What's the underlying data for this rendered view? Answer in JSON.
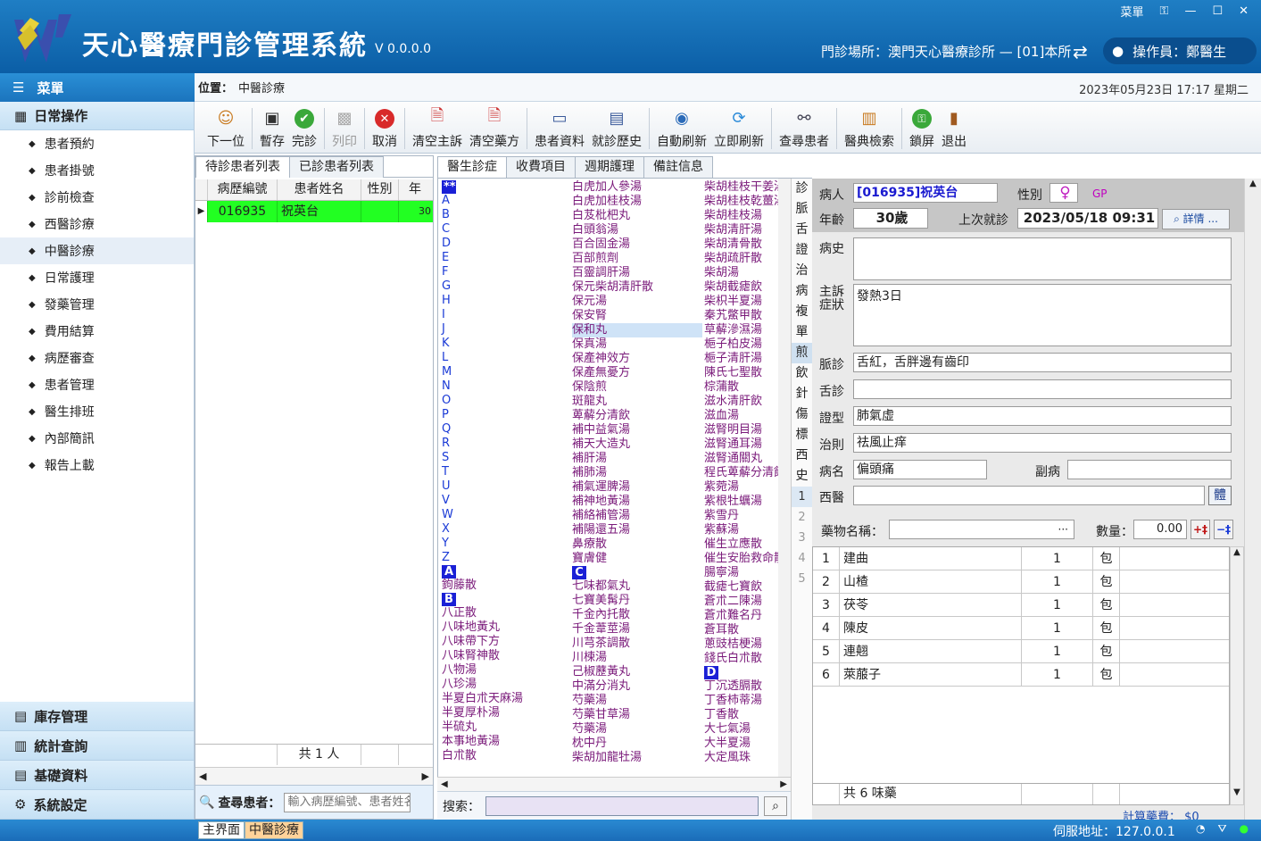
{
  "app": {
    "title": "天心醫療門診管理系統",
    "version": "V 0.0.0.0",
    "menu_label": "菜單",
    "clinic_info": "門診場所：澳門天心醫療診所 — [01]本所",
    "operator": "操作員：鄭醫生",
    "window_menu": "菜單",
    "brand_color": "#0b5ea6"
  },
  "menu": {
    "title": "菜單",
    "section_daily": "日常操作",
    "items": [
      "患者預約",
      "患者掛號",
      "診前檢查",
      "西醫診療",
      "中醫診療",
      "日常護理",
      "發藥管理",
      "費用結算",
      "病歷審查",
      "患者管理",
      "醫生排班",
      "內部簡訊",
      "報告上載"
    ],
    "bottom_sections": [
      "庫存管理",
      "統計查詢",
      "基礎資料",
      "系統設定"
    ]
  },
  "location": {
    "label": "位置：",
    "value": "中醫診療",
    "datetime": "2023年05月23日 17:17  星期二"
  },
  "toolbar": [
    "下一位",
    "暫存",
    "完診",
    "列印",
    "取消",
    "清空主訴",
    "清空藥方",
    "患者資料",
    "就診歷史",
    "自動刷新",
    "立即刷新",
    "查尋患者",
    "醫典檢索",
    "鎖屏",
    "退出"
  ],
  "left_panel": {
    "tabs": [
      "待診患者列表",
      "已診患者列表"
    ],
    "columns": [
      "病歷編號",
      "患者姓名",
      "性別",
      "年"
    ],
    "rows": [
      {
        "id": "016935",
        "name": "祝英台",
        "gender": "",
        "age": "30"
      }
    ],
    "footer_count": "共 1 人",
    "search_label": "查尋患者：",
    "search_placeholder": "輸入病歷編號、患者姓名"
  },
  "mid_panel": {
    "tabs": [
      "醫生診症",
      "收費項目",
      "週期護理",
      "備註信息"
    ],
    "search_label": "搜索："
  },
  "herbs": {
    "col1": [
      "**",
      "A",
      "B",
      "C",
      "D",
      "E",
      "F",
      "G",
      "H",
      "I",
      "J",
      "K",
      "L",
      "M",
      "N",
      "O",
      "P",
      "Q",
      "R",
      "S",
      "T",
      "U",
      "V",
      "W",
      "X",
      "Y",
      "Z",
      "A",
      "鉤藤散",
      "B",
      "八正散",
      "八味地黃丸",
      "八味帶下方",
      "八味腎神散",
      "八物湯",
      "八珍湯",
      "半夏白朮天麻湯",
      "半夏厚朴湯",
      "半硫丸",
      "本事地黃湯",
      "白朮散"
    ],
    "col2": [
      "白虎加人參湯",
      "白虎加桂枝湯",
      "白芨枇杷丸",
      "白頭翁湯",
      "百合固金湯",
      "百部煎劑",
      "百靈調肝湯",
      "保元柴胡清肝散",
      "保元湯",
      "保安腎",
      "保和丸",
      "保真湯",
      "保產神效方",
      "保產無憂方",
      "保陰煎",
      "斑龍丸",
      "萆薢分清飲",
      "補中益氣湯",
      "補天大造丸",
      "補肝湯",
      "補肺湯",
      "補氣運脾湯",
      "補神地黃湯",
      "補絡補管湯",
      "補陽還五湯",
      "鼻療散",
      "寶膚健",
      "C",
      "七味都氣丸",
      "七寶美髯丹",
      "千金內托散",
      "千金葦莖湯",
      "川芎茶調散",
      "川楝湯",
      "己椒藶黃丸",
      "中滿分消丸",
      "芍藥湯",
      "芍藥甘草湯",
      "芍藥湯",
      "枕中丹",
      "柴胡加龍牡湯"
    ],
    "col3": [
      "柴胡桂枝干姜湯",
      "柴胡桂枝乾薑湯",
      "柴胡桂枝湯",
      "柴胡清肝湯",
      "柴胡清骨散",
      "柴胡疏肝散",
      "柴胡湯",
      "柴胡截瘧飲",
      "柴枳半夏湯",
      "秦艽鱉甲散",
      "草薢滲濕湯",
      "梔子柏皮湯",
      "梔子清肝湯",
      "陳氏七聖散",
      "棕蒲散",
      "滋水清肝飲",
      "滋血湯",
      "滋腎明目湯",
      "滋腎通耳湯",
      "滋腎通關丸",
      "程氏萆薢分清飲",
      "紫菀湯",
      "紫根牡蠣湯",
      "紫雪丹",
      "紫蘇湯",
      "催生立應散",
      "催生安胎救命散",
      "腸寧湯",
      "截瘧七寶飲",
      "蒼朮二陳湯",
      "蒼朮難名丹",
      "蒼耳散",
      "蔥豉桔梗湯",
      "錢氏白朮散",
      "D",
      "丁沉透膈散",
      "丁香柿蒂湯",
      "丁香散",
      "大七氣湯",
      "大半夏湯",
      "大定風珠"
    ]
  },
  "vert_tabs": [
    "診",
    "脈",
    "舌",
    "證",
    "治",
    "病",
    "複",
    "單",
    "煎",
    "飲",
    "針",
    "傷",
    "標",
    "西",
    "史"
  ],
  "vert_nums": [
    "1",
    "2",
    "3",
    "4",
    "5"
  ],
  "patient": {
    "label_patient": "病人",
    "name": "[016935]祝英台",
    "label_gender": "性別",
    "gender_symbol": "♀",
    "gp": "GP",
    "label_age": "年齡",
    "age": "30歲",
    "label_last": "上次就診",
    "last_visit": "2023/05/18 09:31",
    "detail_btn": "詳情 ...",
    "label_history": "病史",
    "history": "",
    "label_complaint_1": "主訴",
    "label_complaint_2": "症狀",
    "complaint": "發熱3日",
    "label_pulse": "脈診",
    "pulse": "舌紅，舌胖邊有齒印",
    "label_tongue": "舌診",
    "tongue": "",
    "label_syndrome": "證型",
    "syndrome": "肺氣虛",
    "label_treatment": "治則",
    "treatment": "祛風止痒",
    "label_disease": "病名",
    "disease": "偏頭痛",
    "label_sub": "副病",
    "sub_disease": "",
    "label_western": "西醫",
    "western": "",
    "ti_btn": "體"
  },
  "prescription": {
    "label_name": "藥物名稱：",
    "name_btn": "···",
    "label_qty": "數量：",
    "qty": "0.00",
    "items": [
      {
        "no": "1",
        "name": "建曲",
        "qty": "1",
        "unit": "包"
      },
      {
        "no": "2",
        "name": "山楂",
        "qty": "1",
        "unit": "包"
      },
      {
        "no": "3",
        "name": "茯苓",
        "qty": "1",
        "unit": "包"
      },
      {
        "no": "4",
        "name": "陳皮",
        "qty": "1",
        "unit": "包"
      },
      {
        "no": "5",
        "name": "連翹",
        "qty": "1",
        "unit": "包"
      },
      {
        "no": "6",
        "name": "萊菔子",
        "qty": "1",
        "unit": "包"
      }
    ],
    "total": "共 6 味藥",
    "calc_fee": "計算藥費： $0"
  },
  "statusbar": {
    "tabs": [
      "主界面",
      "中醫診療"
    ],
    "server": "伺服地址：127.0.0.1"
  }
}
